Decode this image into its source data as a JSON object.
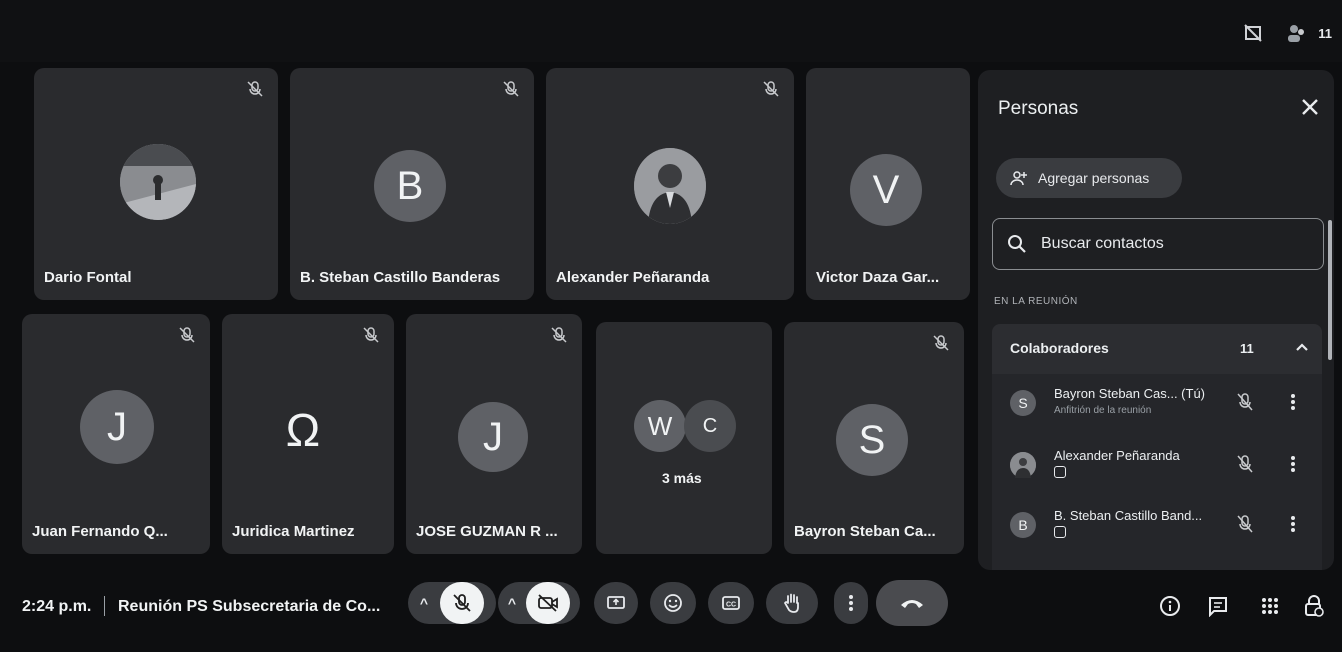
{
  "top": {
    "participant_count": "11"
  },
  "tiles": [
    {
      "name": "Dario Fontal"
    },
    {
      "name": "B. Steban Castillo Banderas",
      "initial": "B"
    },
    {
      "name": "Alexander Peñaranda"
    },
    {
      "name": "Victor Daza Gar...",
      "initial": "V"
    },
    {
      "name": "Juan Fernando Q...",
      "initial": "J"
    },
    {
      "name": "Juridica Martinez",
      "initial": "Ω"
    },
    {
      "name": "JOSE GUZMAN R ...",
      "initial": "J"
    },
    {
      "initials": [
        "W",
        "C"
      ],
      "more": "3 más"
    },
    {
      "name": "Bayron Steban Ca...",
      "initial": "S"
    }
  ],
  "panel": {
    "title": "Personas",
    "add_label": "Agregar personas",
    "search_placeholder": "Buscar contactos",
    "section_label": "EN LA REUNIÓN",
    "group_label": "Colaboradores",
    "group_count": "11",
    "participants": [
      {
        "initial": "S",
        "name": "Bayron Steban Cas...  (Tú)",
        "sub": "Anfitrión de la reunión"
      },
      {
        "name": "Alexander Peñaranda"
      },
      {
        "initial": "B",
        "name": "B. Steban Castillo Band..."
      }
    ]
  },
  "bottom": {
    "time": "2:24 p.m.",
    "meeting_title": "Reunión PS Subsecretaria de Co..."
  },
  "icons": {
    "mic_off": "mic-off-icon",
    "cam_off": "camera-off-icon",
    "present": "present-screen-icon",
    "emoji": "emoji-icon",
    "captions": "captions-icon",
    "hand": "raise-hand-icon",
    "more": "more-vert-icon",
    "end_call": "end-call-icon",
    "info": "info-icon",
    "chat": "chat-icon",
    "activities": "activities-icon",
    "lock": "host-controls-icon"
  }
}
